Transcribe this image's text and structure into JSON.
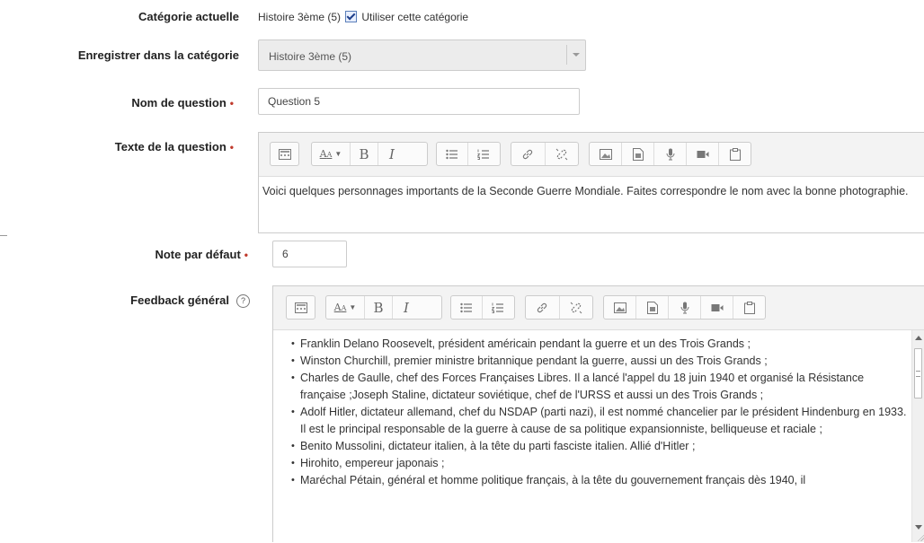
{
  "form": {
    "current_category": {
      "label": "Catégorie actuelle",
      "value": "Histoire 3ème (5)",
      "checkbox_label": "Utiliser cette catégorie",
      "checked": true
    },
    "save_in_category": {
      "label": "Enregistrer dans la catégorie",
      "selected": "Histoire 3ème (5)"
    },
    "question_name": {
      "label": "Nom de question",
      "value": "Question 5"
    },
    "question_text": {
      "label": "Texte de la question",
      "content": "Voici quelques personnages importants de la Seconde Guerre Mondiale. Faites correspondre le nom avec la bonne photographie."
    },
    "default_mark": {
      "label": "Note par défaut",
      "value": "6"
    },
    "general_feedback": {
      "label": "Feedback général",
      "items": [
        "Franklin Delano Roosevelt, président américain pendant la guerre et un des Trois Grands ;",
        "Winston Churchill, premier ministre britannique pendant la guerre, aussi un des Trois Grands ;",
        "Charles de Gaulle, chef des Forces Françaises Libres. Il a lancé l'appel du 18 juin 1940 et organisé la Résistance française ;Joseph Staline, dictateur soviétique, chef de l'URSS et aussi un des Trois Grands ;",
        "Adolf Hitler, dictateur allemand, chef du NSDAP (parti nazi), il est nommé chancelier par le président Hindenburg en 1933. Il est le principal responsable de la guerre à cause de sa politique expansionniste, belliqueuse et raciale ;",
        "Benito Mussolini, dictateur italien, à la tête du parti fasciste italien. Allié d'Hitler ;",
        "Hirohito, empereur japonais ;",
        "Maréchal Pétain, général et homme politique français, à la tête du gouvernement français dès 1940, il"
      ]
    },
    "required_marker": "•",
    "help_glyph": "?"
  },
  "toolbar": {
    "bold": "B",
    "italic": "I",
    "icons": [
      "toolbar-toggle-icon",
      "font-size-icon",
      "bold-icon",
      "italic-icon",
      "unordered-list-icon",
      "ordered-list-icon",
      "link-icon",
      "unlink-icon",
      "image-icon",
      "media-icon",
      "record-audio-icon",
      "record-video-icon",
      "manage-files-icon"
    ]
  },
  "colors": {
    "required": "#c0392b",
    "label": "#222222",
    "border": "#cccccc"
  }
}
